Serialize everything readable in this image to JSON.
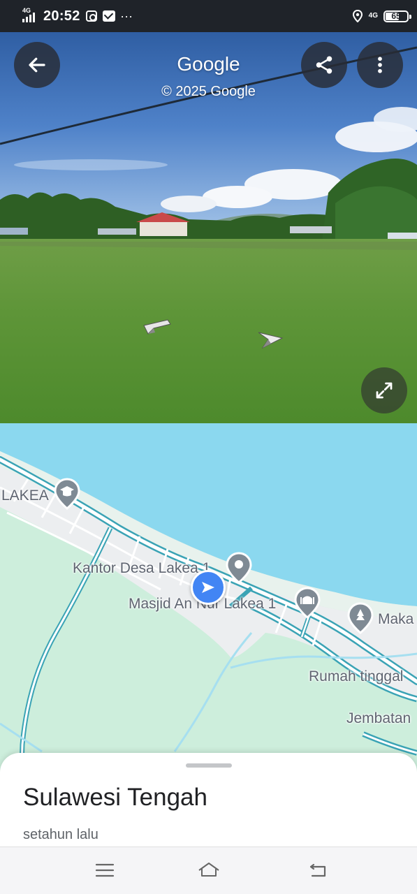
{
  "status_bar": {
    "network_type": "4G",
    "time": "20:52",
    "notification_icons": [
      "instagram-icon",
      "mail-icon",
      "more-notifications-icon"
    ],
    "right_network_type": "4G",
    "battery_level": "65",
    "battery_fraction": 0.65
  },
  "street_view": {
    "title": "Google",
    "copyright": "© 2025 Google",
    "buttons": {
      "back": "arrow-left-icon",
      "share": "share-icon",
      "more": "more-vert-icon",
      "expand": "expand-icon"
    }
  },
  "map": {
    "labels": {
      "lakea": "LAKEA",
      "kantor_desa": "Kantor Desa Lakea 1",
      "masjid": "Masjid An Nur Lakea 1",
      "makam": "Maka",
      "rumah_tinggal": "Rumah tinggal",
      "jembatan": "Jembatan"
    },
    "colors": {
      "water": "#8bd8ef",
      "land": "#cdeedc",
      "road_outline": "#3aa3b5",
      "user_marker": "#4285f4",
      "pin": "#7f8a94"
    }
  },
  "sheet": {
    "title": "Sulawesi Tengah",
    "subtitle": "setahun lalu"
  },
  "system_nav": {
    "menu": "menu-icon",
    "home": "home-icon",
    "back": "back-icon"
  }
}
